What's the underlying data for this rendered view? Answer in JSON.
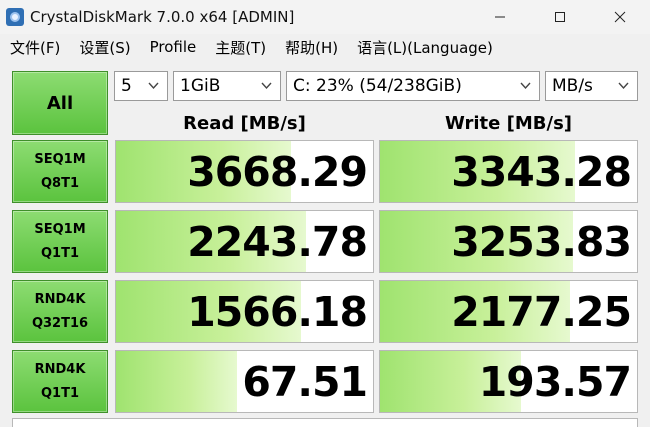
{
  "window": {
    "title": "CrystalDiskMark 7.0.0 x64 [ADMIN]",
    "controls": {
      "minimize": "minimize",
      "maximize": "maximize",
      "close": "close"
    }
  },
  "menu": [
    {
      "label": "文件(F)"
    },
    {
      "label": "设置(S)"
    },
    {
      "label": "Profile"
    },
    {
      "label": "主题(T)"
    },
    {
      "label": "帮助(H)"
    },
    {
      "label": "语言(L)(Language)"
    }
  ],
  "controls": {
    "all_label": "All",
    "count": "5",
    "size": "1GiB",
    "drive": "C: 23% (54/238GiB)",
    "unit": "MB/s"
  },
  "columns": {
    "read": "Read [MB/s]",
    "write": "Write [MB/s]"
  },
  "tests": [
    {
      "line1": "SEQ1M",
      "line2": "Q8T1",
      "read": "3668.29",
      "write": "3343.28",
      "read_fill": 0.68,
      "write_fill": 0.76
    },
    {
      "line1": "SEQ1M",
      "line2": "Q1T1",
      "read": "2243.78",
      "write": "3253.83",
      "read_fill": 0.74,
      "write_fill": 0.75
    },
    {
      "line1": "RND4K",
      "line2": "Q32T16",
      "read": "1566.18",
      "write": "2177.25",
      "read_fill": 0.72,
      "write_fill": 0.74
    },
    {
      "line1": "RND4K",
      "line2": "Q1T1",
      "read": "67.51",
      "write": "193.57",
      "read_fill": 0.47,
      "write_fill": 0.55
    }
  ],
  "colors": {
    "accent_green": "#5bc33e",
    "bar_green": "#9fe36f"
  },
  "icons": {
    "app": "crystaldiskmark-icon",
    "dropdown": "chevron-down-icon"
  }
}
